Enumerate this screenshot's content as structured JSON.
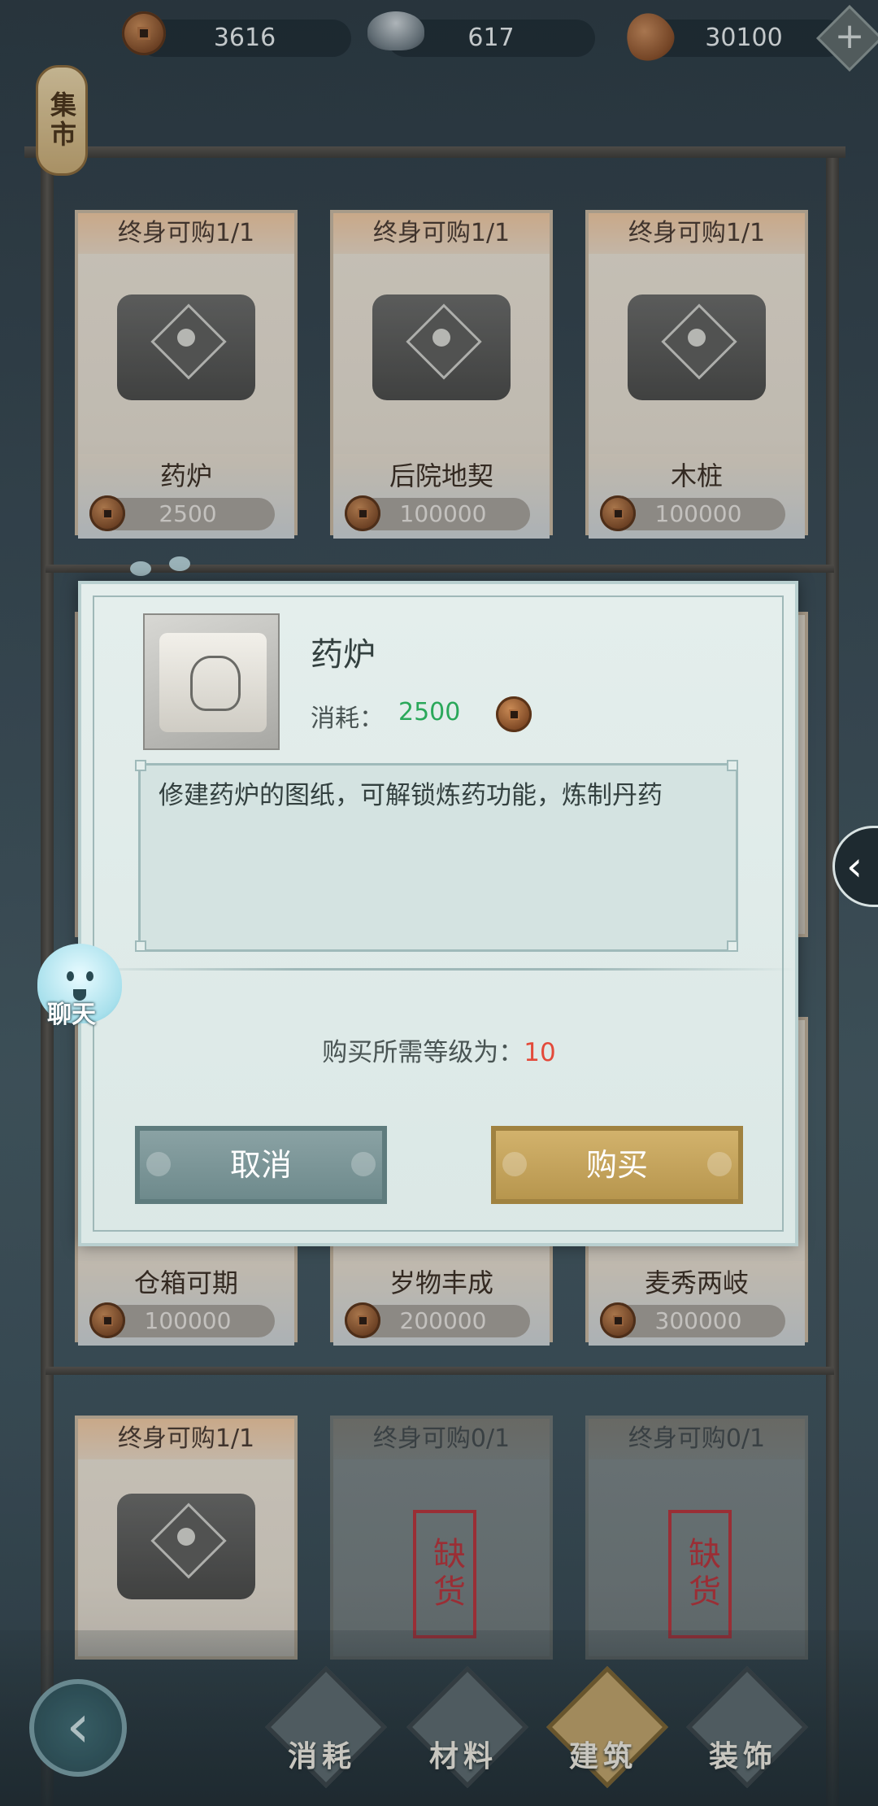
{
  "currency": {
    "copper": "3616",
    "silver": "617",
    "shell": "30100",
    "add_symbol": "+"
  },
  "market_sign": "集市",
  "shelf_row1": [
    {
      "limit": "终身可购1/1",
      "name": "药炉",
      "price": "2500"
    },
    {
      "limit": "终身可购1/1",
      "name": "后院地契",
      "price": "100000"
    },
    {
      "limit": "终身可购1/1",
      "name": "木桩",
      "price": "100000"
    }
  ],
  "shelf_row3": [
    {
      "name": "仓箱可期",
      "price": "100000"
    },
    {
      "name": "岁物丰成",
      "price": "200000"
    },
    {
      "name": "麦秀两岐",
      "price": "300000"
    }
  ],
  "shelf_row4": [
    {
      "limit": "终身可购1/1",
      "stamp": ""
    },
    {
      "limit": "终身可购0/1",
      "stamp": "缺货"
    },
    {
      "limit": "终身可购0/1",
      "stamp": "缺货"
    }
  ],
  "dialog": {
    "item_name": "药炉",
    "cost_label": "消耗：",
    "cost_value": "2500",
    "description": "修建药炉的图纸，可解锁炼药功能，炼制丹药",
    "requirement_label": "购买所需等级为：",
    "requirement_level": "10",
    "cancel_label": "取消",
    "buy_label": "购买"
  },
  "chat_label": "聊天",
  "nav": [
    {
      "label": "消耗",
      "active": false
    },
    {
      "label": "材料",
      "active": false
    },
    {
      "label": "建筑",
      "active": true
    },
    {
      "label": "装饰",
      "active": false
    }
  ],
  "colors": {
    "cost_green": "#2aa85a",
    "level_red": "#e34a3a",
    "buy_gold": "#c2a35e",
    "cancel_teal": "#7d9799"
  }
}
